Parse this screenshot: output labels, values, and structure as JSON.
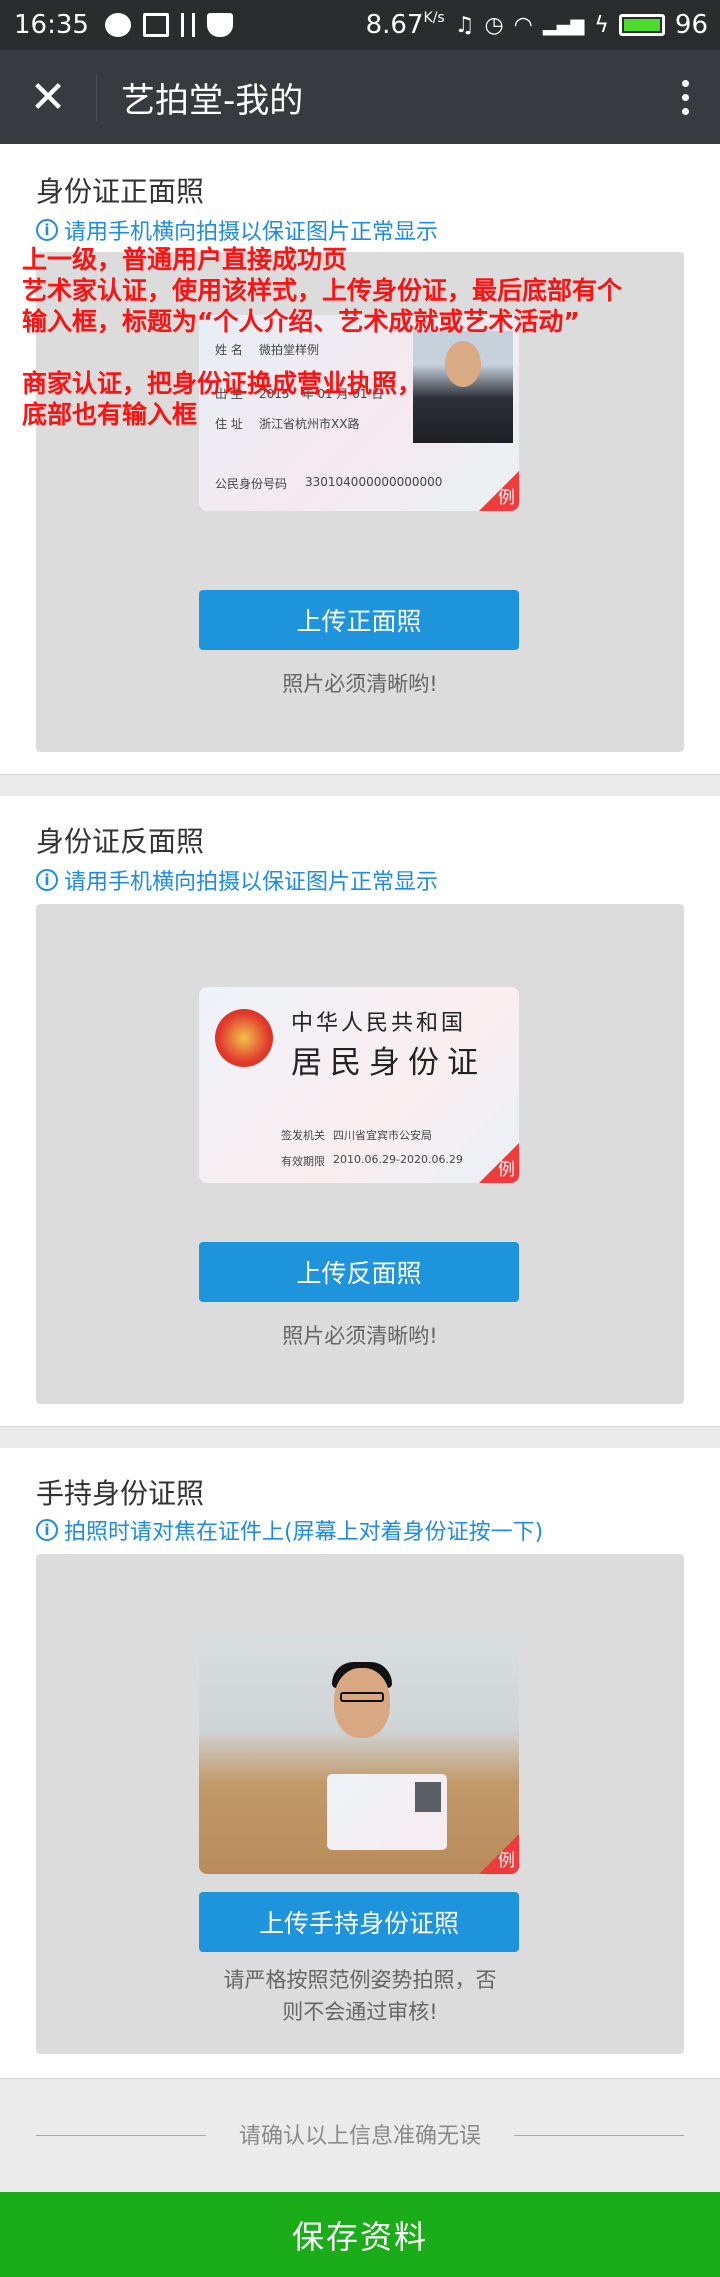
{
  "status_bar": {
    "time": "16:35",
    "speed": "8.67",
    "speed_unit": "K/s",
    "battery": "96",
    "icons": [
      "weibo-icon",
      "image-icon",
      "usb-icon",
      "shield-icon",
      "headphones-icon",
      "alarm-icon",
      "wifi-icon",
      "signal-4g-icon",
      "charging-icon",
      "battery-icon"
    ]
  },
  "header": {
    "title": "艺拍堂-我的",
    "close_icon": "close-icon",
    "more_icon": "more-vertical-icon"
  },
  "sections": [
    {
      "title": "身份证正面照",
      "tip": "请用手机横向拍摄以保证图片正常显示",
      "button": "上传正面照",
      "hint": "照片必须清晰哟!",
      "sample": {
        "name_label": "姓 名",
        "name_value": "微拍堂样例",
        "birth_label": "出 生",
        "birth_value": "2015　年 01 月 01 日",
        "address_label": "住 址",
        "address_value": "浙江省杭州市XX路",
        "id_label": "公民身份号码",
        "id_value": "330104000000000000",
        "badge": "例"
      }
    },
    {
      "title": "身份证反面照",
      "tip": "请用手机横向拍摄以保证图片正常显示",
      "button": "上传反面照",
      "hint": "照片必须清晰哟!",
      "sample": {
        "country": "中华人民共和国",
        "card_name": "居民身份证",
        "authority_label": "签发机关",
        "authority_value": "四川省宜宾市公安局",
        "validity_label": "有效期限",
        "validity_value": "2010.06.29-2020.06.29",
        "badge": "例"
      }
    },
    {
      "title": "手持身份证照",
      "tip": "拍照时请对焦在证件上(屏幕上对着身份证按一下)",
      "button": "上传手持身份证照",
      "hint_lines": [
        "请严格按照范例姿势拍照，否",
        "则不会通过审核!"
      ],
      "sample": {
        "badge": "例"
      }
    }
  ],
  "confirm_text": "请确认以上信息准确无误",
  "save_button": "保存资料",
  "annotation": {
    "lines": [
      "上一级，普通用户直接成功页",
      "艺术家认证，使用该样式，上传身份证，最后底部有个",
      "输入框，标题为“个人介绍、艺术成就或艺术活动”",
      "",
      "商家认证，把身份证换成营业执照，",
      "底部也有输入框"
    ]
  },
  "colors": {
    "status_bar": "#2b2c2e",
    "title_bar": "#393a3f",
    "accent_blue": "#1e94dc",
    "tip_blue": "#1e8ce0",
    "save_green": "#1aad19",
    "note_red": "#ff1111",
    "example_red": "#ef3b3b"
  }
}
